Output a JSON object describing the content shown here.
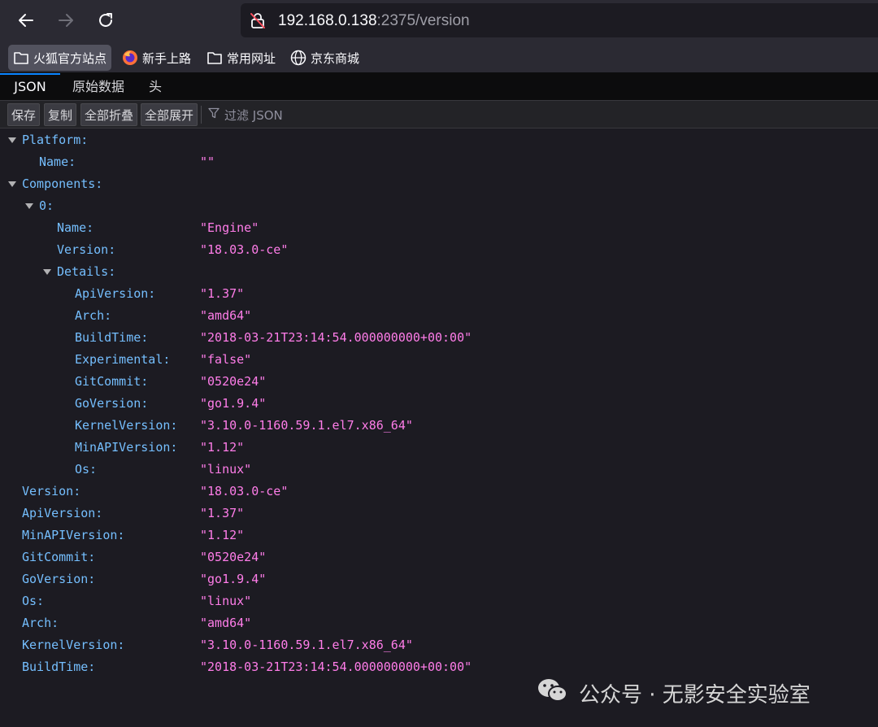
{
  "browser": {
    "url_host": "192.168.0.138",
    "url_rest": ":2375/version",
    "icons": {
      "back": "arrow-left-icon",
      "forward": "arrow-right-icon",
      "reload": "reload-icon",
      "insecure": "insecure-lock-icon"
    }
  },
  "bookmarks": [
    {
      "label": "火狐官方站点",
      "icon": "folder-icon"
    },
    {
      "label": "新手上路",
      "icon": "firefox-icon"
    },
    {
      "label": "常用网址",
      "icon": "folder-icon"
    },
    {
      "label": "京东商城",
      "icon": "globe-icon"
    }
  ],
  "viewer": {
    "tabs": [
      "JSON",
      "原始数据",
      "头"
    ],
    "toolbar": {
      "save": "保存",
      "copy": "复制",
      "collapse_all": "全部折叠",
      "expand_all": "全部展开",
      "filter_placeholder": "过滤 JSON"
    }
  },
  "json": {
    "platform_key": "Platform:",
    "platform_name_key": "Name:",
    "platform_name_val": "\"\"",
    "components_key": "Components:",
    "comp0_key": "0:",
    "comp0_name_key": "Name:",
    "comp0_name_val": "\"Engine\"",
    "comp0_version_key": "Version:",
    "comp0_version_val": "\"18.03.0-ce\"",
    "details_key": "Details:",
    "details": [
      {
        "k": "ApiVersion:",
        "v": "\"1.37\""
      },
      {
        "k": "Arch:",
        "v": "\"amd64\""
      },
      {
        "k": "BuildTime:",
        "v": "\"2018-03-21T23:14:54.000000000+00:00\""
      },
      {
        "k": "Experimental:",
        "v": "\"false\""
      },
      {
        "k": "GitCommit:",
        "v": "\"0520e24\""
      },
      {
        "k": "GoVersion:",
        "v": "\"go1.9.4\""
      },
      {
        "k": "KernelVersion:",
        "v": "\"3.10.0-1160.59.1.el7.x86_64\""
      },
      {
        "k": "MinAPIVersion:",
        "v": "\"1.12\""
      },
      {
        "k": "Os:",
        "v": "\"linux\""
      }
    ],
    "top": [
      {
        "k": "Version:",
        "v": "\"18.03.0-ce\""
      },
      {
        "k": "ApiVersion:",
        "v": "\"1.37\""
      },
      {
        "k": "MinAPIVersion:",
        "v": "\"1.12\""
      },
      {
        "k": "GitCommit:",
        "v": "\"0520e24\""
      },
      {
        "k": "GoVersion:",
        "v": "\"go1.9.4\""
      },
      {
        "k": "Os:",
        "v": "\"linux\""
      },
      {
        "k": "Arch:",
        "v": "\"amd64\""
      },
      {
        "k": "KernelVersion:",
        "v": "\"3.10.0-1160.59.1.el7.x86_64\""
      },
      {
        "k": "BuildTime:",
        "v": "\"2018-03-21T23:14:54.000000000+00:00\""
      }
    ]
  },
  "watermark": {
    "text": "公众号 · 无影安全实验室",
    "icon": "wechat-icon"
  },
  "colors": {
    "json_key": "#75bfff",
    "json_string": "#ff7de9",
    "active_tab": "#0a84ff",
    "background": "#1c1b22"
  }
}
